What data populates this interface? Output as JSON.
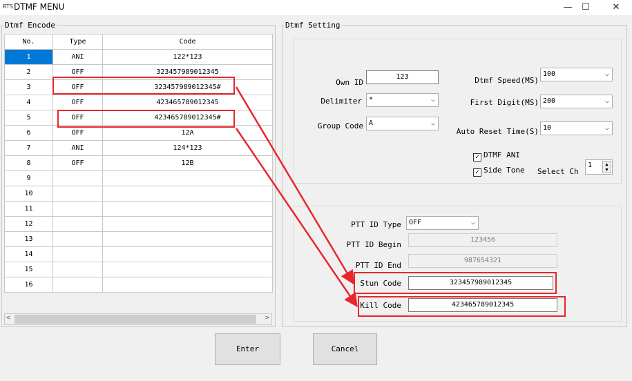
{
  "window": {
    "icon_text": "RTS",
    "title": "DTMF MENU",
    "minimize_glyph": "—",
    "maximize_glyph": "☐",
    "close_glyph": "✕"
  },
  "encode": {
    "legend": "Dtmf Encode",
    "columns": [
      "No.",
      "Type",
      "Code"
    ],
    "rows": [
      {
        "no": "1",
        "type": "ANI",
        "code": "122*123"
      },
      {
        "no": "2",
        "type": "OFF",
        "code": "323457989012345"
      },
      {
        "no": "3",
        "type": "OFF",
        "code": "323457989012345#"
      },
      {
        "no": "4",
        "type": "OFF",
        "code": "423465789012345"
      },
      {
        "no": "5",
        "type": "OFF",
        "code": "423465789012345#"
      },
      {
        "no": "6",
        "type": "OFF",
        "code": "12A"
      },
      {
        "no": "7",
        "type": "ANI",
        "code": "124*123"
      },
      {
        "no": "8",
        "type": "OFF",
        "code": "12B"
      },
      {
        "no": "9",
        "type": "",
        "code": ""
      },
      {
        "no": "10",
        "type": "",
        "code": ""
      },
      {
        "no": "11",
        "type": "",
        "code": ""
      },
      {
        "no": "12",
        "type": "",
        "code": ""
      },
      {
        "no": "13",
        "type": "",
        "code": ""
      },
      {
        "no": "14",
        "type": "",
        "code": ""
      },
      {
        "no": "15",
        "type": "",
        "code": ""
      },
      {
        "no": "16",
        "type": "",
        "code": ""
      }
    ],
    "scroll_left": "<",
    "scroll_right": ">"
  },
  "setting": {
    "legend": "Dtmf Setting",
    "own_id_label": "Own ID",
    "own_id_value": "123",
    "delimiter_label": "Delimiter",
    "delimiter_value": "*",
    "group_code_label": "Group Code",
    "group_code_value": "A",
    "speed_label": "Dtmf Speed(MS)",
    "speed_value": "100",
    "first_digit_label": "First Digit(MS)",
    "first_digit_value": "200",
    "auto_reset_label": "Auto Reset Time(S)",
    "auto_reset_value": "10",
    "dtmf_ani_label": "DTMF ANI",
    "dtmf_ani_checked": true,
    "side_tone_label": "Side Tone",
    "side_tone_checked": true,
    "select_ch_label": "Select Ch",
    "select_ch_value": "1",
    "ptt_id_type_label": "PTT ID Type",
    "ptt_id_type_value": "OFF",
    "ptt_id_begin_label": "PTT ID Begin",
    "ptt_id_begin_value": "123456",
    "ptt_id_end_label": "PTT ID End",
    "ptt_id_end_value": "987654321",
    "stun_code_label": "Stun Code",
    "stun_code_value": "323457989012345",
    "kill_code_label": "Kill Code",
    "kill_code_value": "423465789012345"
  },
  "buttons": {
    "enter": "Enter",
    "cancel": "Cancel"
  },
  "annotation": {
    "color": "#e8262b"
  },
  "selection": {
    "color": "#0078d7",
    "selected_row": "1"
  }
}
